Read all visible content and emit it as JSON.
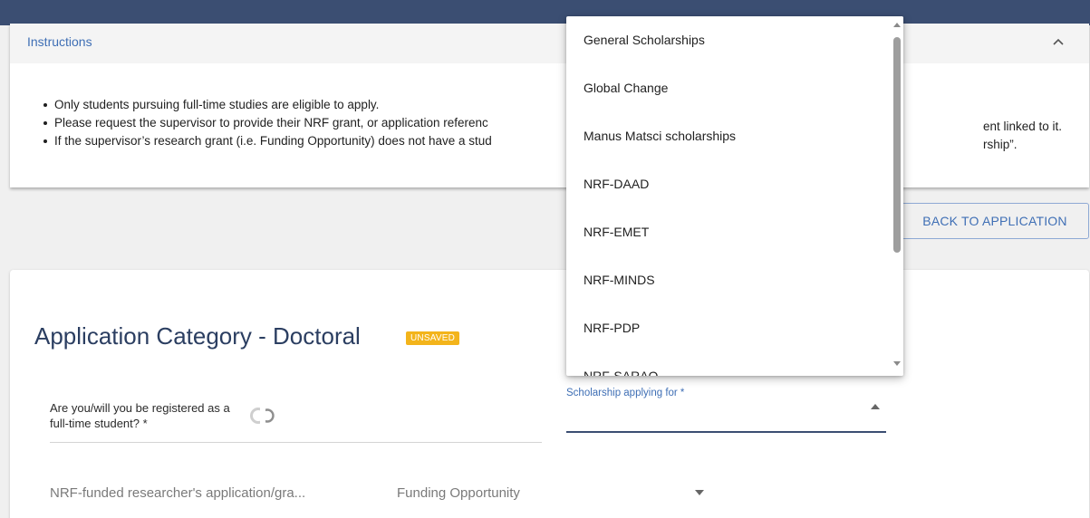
{
  "instructions": {
    "title": "Instructions",
    "items": [
      "Only students pursuing full-time studies are eligible to apply.",
      "Please request the supervisor to provide their NRF grant, or application referenc",
      "If the supervisor’s research grant (i.e. Funding Opportunity) does not have a stud"
    ],
    "tail_line_2": "ent linked to it.",
    "tail_line_3": "rship”."
  },
  "actions": {
    "back_to_application": "BACK TO APPLICATION"
  },
  "application": {
    "title": "Application Category - Doctoral",
    "status_badge": "UNSAVED",
    "fulltime_question": "Are you/will you be registered as a full-time student? *",
    "researcher_field_label": "NRF-funded researcher's application/gra...",
    "funding_opportunity_label": "Funding Opportunity",
    "scholarship_field_label": "Scholarship applying for *"
  },
  "scholarship_dropdown": {
    "options": [
      "General Scholarships",
      "Global Change",
      "Manus Matsci scholarships",
      "NRF-DAAD",
      "NRF-EMET",
      "NRF-MINDS",
      "NRF-PDP",
      "NRF-SARAO"
    ]
  },
  "colors": {
    "topbar": "#3b4e72",
    "accent": "#3f6fb5",
    "badge": "#f3b41b"
  }
}
